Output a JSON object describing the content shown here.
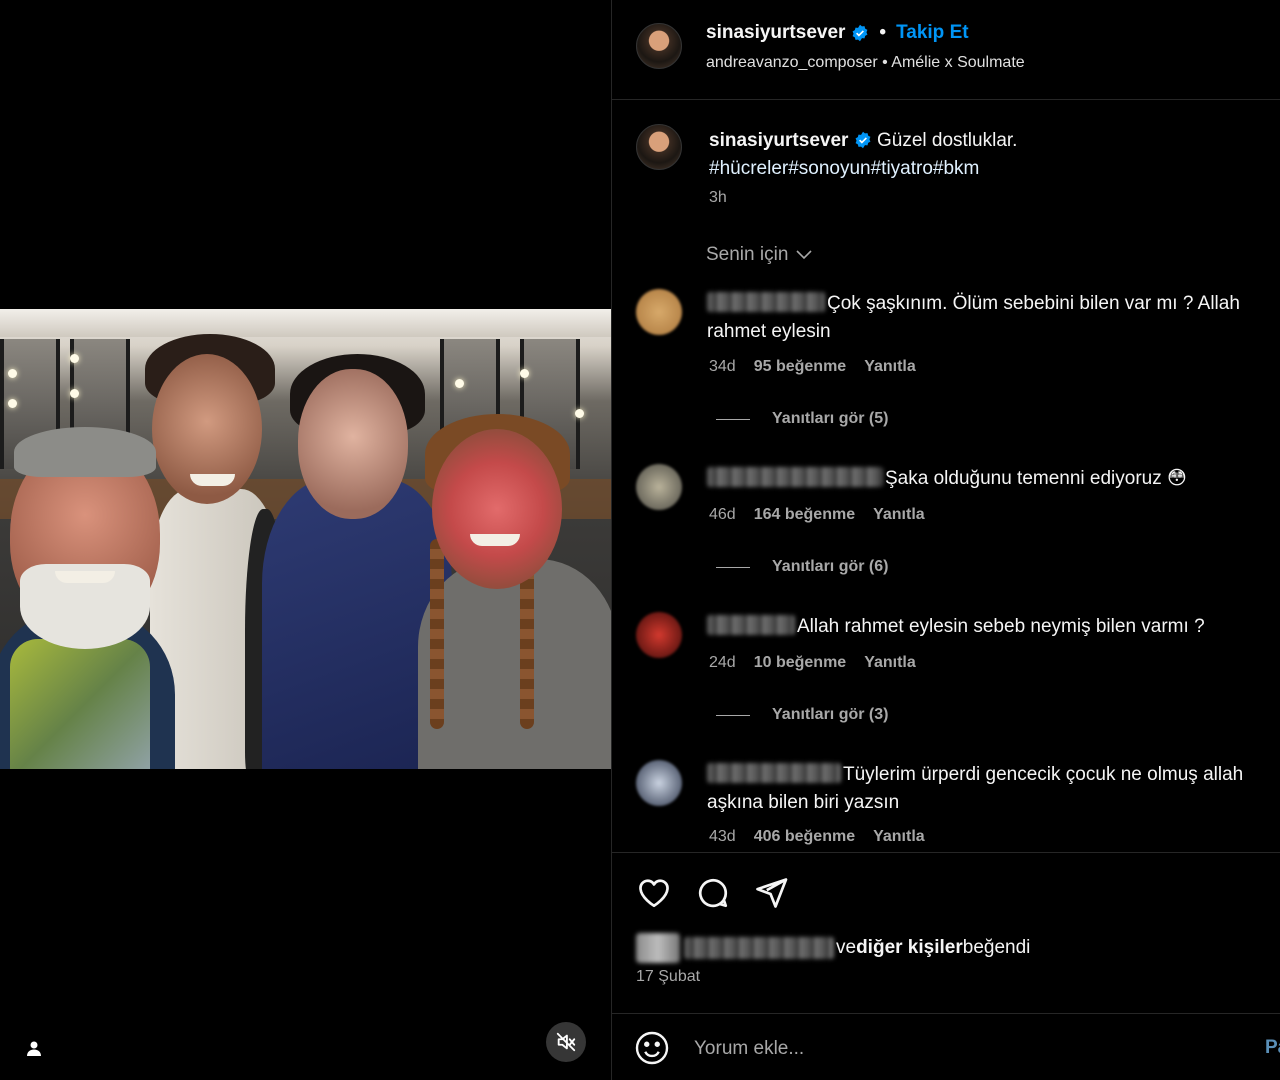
{
  "post": {
    "username": "sinasiyurtsever",
    "follow_label": "Takip Et",
    "separator": "•",
    "audio_subtitle": "andreavanzo_composer • Amélie x Soulmate"
  },
  "caption": {
    "username": "sinasiyurtsever",
    "text": "Güzel dostluklar.",
    "hashtags": "#hücreler#sonoyun#tiyatro#bkm",
    "time": "3h"
  },
  "sort_label": "Senin için",
  "comments": [
    {
      "text": "Çok şaşkınım. Ölüm sebebini bilen var mı ? Allah rahmet eylesin",
      "time": "34d",
      "likes": "95 beğenme",
      "reply_label": "Yanıtla",
      "view_replies": "Yanıtları gör (5)"
    },
    {
      "text": "Şaka olduğunu temenni ediyoruz 😳",
      "time": "46d",
      "likes": "164 beğenme",
      "reply_label": "Yanıtla",
      "view_replies": "Yanıtları gör (6)"
    },
    {
      "text": "Allah rahmet eylesin sebeb neymiş bilen varmı ?",
      "time": "24d",
      "likes": "10 beğenme",
      "reply_label": "Yanıtla",
      "view_replies": "Yanıtları gör (3)"
    },
    {
      "text": "Tüylerim ürperdi gencecik çocuk ne olmuş allah aşkına bilen biri yazsın",
      "time": "43d",
      "likes": "406 beğenme",
      "reply_label": "Yanıtla"
    }
  ],
  "liked_by": {
    "prefix": "ve ",
    "others": "diğer kişiler",
    "suffix": " beğendi"
  },
  "date": "17 Şubat",
  "composer": {
    "placeholder": "Yorum ekle...",
    "post_label": "Paylaş"
  },
  "icons": {
    "like": "heart-icon",
    "comment": "comment-bubble-icon",
    "share": "paper-plane-icon",
    "emoji": "emoji-icon",
    "mute": "speaker-muted-icon",
    "tag": "user-tag-icon",
    "verified": "verified-badge-icon",
    "sort": "chevron-down-icon"
  },
  "colors": {
    "link_blue": "#0095f6",
    "background": "#000000",
    "muted_text": "#a8a8a8"
  }
}
